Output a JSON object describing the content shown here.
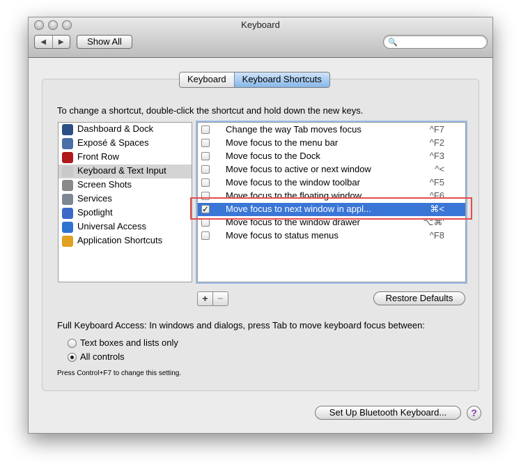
{
  "window": {
    "title": "Keyboard",
    "show_all_label": "Show All",
    "back_symbol": "◀",
    "forward_symbol": "▶",
    "search_placeholder": "",
    "search_icon": "🔍"
  },
  "tabs": [
    {
      "label": "Keyboard",
      "active": false
    },
    {
      "label": "Keyboard Shortcuts",
      "active": true
    }
  ],
  "instruction": "To change a shortcut, double-click the shortcut and hold down the new keys.",
  "categories": [
    {
      "label": "Dashboard & Dock",
      "icon": "dashboard-dock-icon",
      "color": "#2b4f86",
      "selected": false
    },
    {
      "label": "Exposé & Spaces",
      "icon": "expose-spaces-icon",
      "color": "#4a6fa8",
      "selected": false
    },
    {
      "label": "Front Row",
      "icon": "front-row-icon",
      "color": "#b0181a",
      "selected": false
    },
    {
      "label": "Keyboard & Text Input",
      "icon": "keyboard-text-input-icon",
      "color": "#c9c9c9",
      "selected": true
    },
    {
      "label": "Screen Shots",
      "icon": "screen-shots-icon",
      "color": "#8a8a8a",
      "selected": false
    },
    {
      "label": "Services",
      "icon": "services-gear-icon",
      "color": "#7d8793",
      "selected": false
    },
    {
      "label": "Spotlight",
      "icon": "spotlight-icon",
      "color": "#3c69c9",
      "selected": false
    },
    {
      "label": "Universal Access",
      "icon": "universal-access-icon",
      "color": "#2f73d0",
      "selected": false
    },
    {
      "label": "Application Shortcuts",
      "icon": "application-shortcuts-icon",
      "color": "#e0a020",
      "selected": false
    }
  ],
  "shortcuts": [
    {
      "label": "Change the way Tab moves focus",
      "key": "^F7",
      "checked": false,
      "selected": false
    },
    {
      "label": "Move focus to the menu bar",
      "key": "^F2",
      "checked": false,
      "selected": false
    },
    {
      "label": "Move focus to the Dock",
      "key": "^F3",
      "checked": false,
      "selected": false
    },
    {
      "label": "Move focus to active or next window",
      "key": "^<",
      "checked": false,
      "selected": false
    },
    {
      "label": "Move focus to the window toolbar",
      "key": "^F5",
      "checked": false,
      "selected": false
    },
    {
      "label": "Move focus to the floating window",
      "key": "^F6",
      "checked": false,
      "selected": false
    },
    {
      "label": "Move focus to next window in appl...",
      "key": "⌘<",
      "checked": true,
      "selected": true
    },
    {
      "label": "Move focus to the window drawer",
      "key": "⌥⌘'",
      "checked": false,
      "selected": false
    },
    {
      "label": "Move focus to status menus",
      "key": "^F8",
      "checked": false,
      "selected": false
    }
  ],
  "add_label": "+",
  "remove_label": "−",
  "restore_defaults_label": "Restore Defaults",
  "full_keyboard_access": {
    "text": "Full Keyboard Access: In windows and dialogs, press Tab to move keyboard focus between:",
    "options": [
      {
        "label": "Text boxes and lists only",
        "selected": false
      },
      {
        "label": "All controls",
        "selected": true
      }
    ],
    "note": "Press Control+F7 to change this setting."
  },
  "bluetooth_label": "Set Up Bluetooth Keyboard...",
  "help_label": "?",
  "colors": {
    "selection": "#3976d6",
    "highlight_box": "#e74c4c"
  }
}
